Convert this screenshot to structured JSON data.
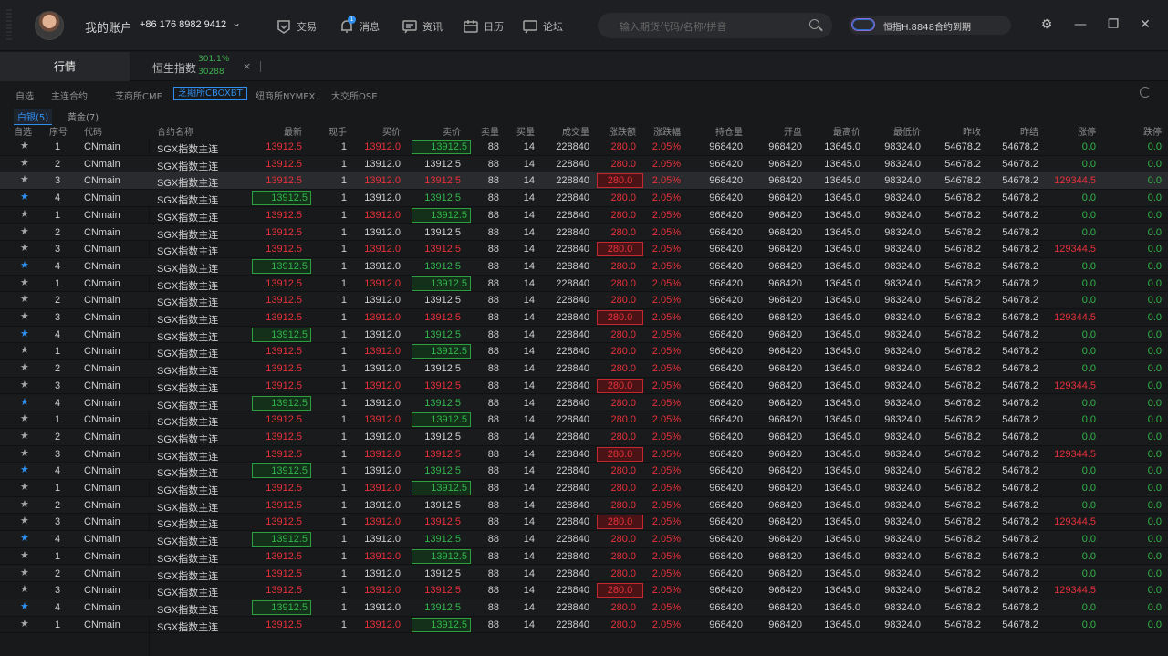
{
  "header": {
    "account_label": "我的账户",
    "phone": "+86 176 8982 9412",
    "nav": [
      {
        "label": "交易",
        "icon": "trade-icon"
      },
      {
        "label": "消息",
        "icon": "bell-icon",
        "badge": "1"
      },
      {
        "label": "资讯",
        "icon": "news-icon"
      },
      {
        "label": "日历",
        "icon": "calendar-icon"
      },
      {
        "label": "论坛",
        "icon": "forum-icon"
      }
    ],
    "search_placeholder": "输入期货代码/名称/拼音",
    "notice": "恒指H.8848合约到期"
  },
  "tabs": {
    "active": "行情",
    "second": {
      "label": "恒生指数",
      "value1": "301.1%",
      "value2": "30288"
    }
  },
  "exchanges": [
    "自选",
    "主连合约",
    "芝商所CME",
    "芝期所CBOXBT",
    "纽商所NYMEX",
    "大交所OSE"
  ],
  "active_exchange": "芝期所CBOXBT",
  "categories": [
    {
      "label": "白银(5)"
    },
    {
      "label": "黄金(7)"
    }
  ],
  "columns": [
    "自选",
    "序号",
    "代码",
    "合约名称",
    "最新",
    "现手",
    "买价",
    "卖价",
    "卖量",
    "买量",
    "成交量",
    "涨跌额",
    "涨跌幅",
    "持仓量",
    "开盘",
    "最高价",
    "最低价",
    "昨收",
    "昨结",
    "涨停",
    "跌停"
  ],
  "common": {
    "code": "CNmain",
    "name": "SGX指数主连",
    "last": "13912.5",
    "hand": "1",
    "bid": "13912.0",
    "ask": "13912.5",
    "ask_vol": "88",
    "bid_vol": "14",
    "volume": "228840",
    "change": "280.0",
    "change_pct": "2.05%",
    "oi": "968420",
    "open": "968420",
    "high": "13645.0",
    "low": "98324.0",
    "prev_close": "54678.2",
    "prev_settle": "54678.2",
    "limit_up_hi": "129344.5",
    "limit_up": "0.0",
    "limit_down": "0.0"
  },
  "rows": [
    1,
    2,
    3,
    4,
    1,
    2,
    3,
    4,
    1,
    2,
    3,
    4,
    1,
    2,
    3,
    4,
    1,
    2,
    3,
    4,
    1,
    2,
    3,
    4,
    1,
    2,
    3,
    4,
    1
  ]
}
